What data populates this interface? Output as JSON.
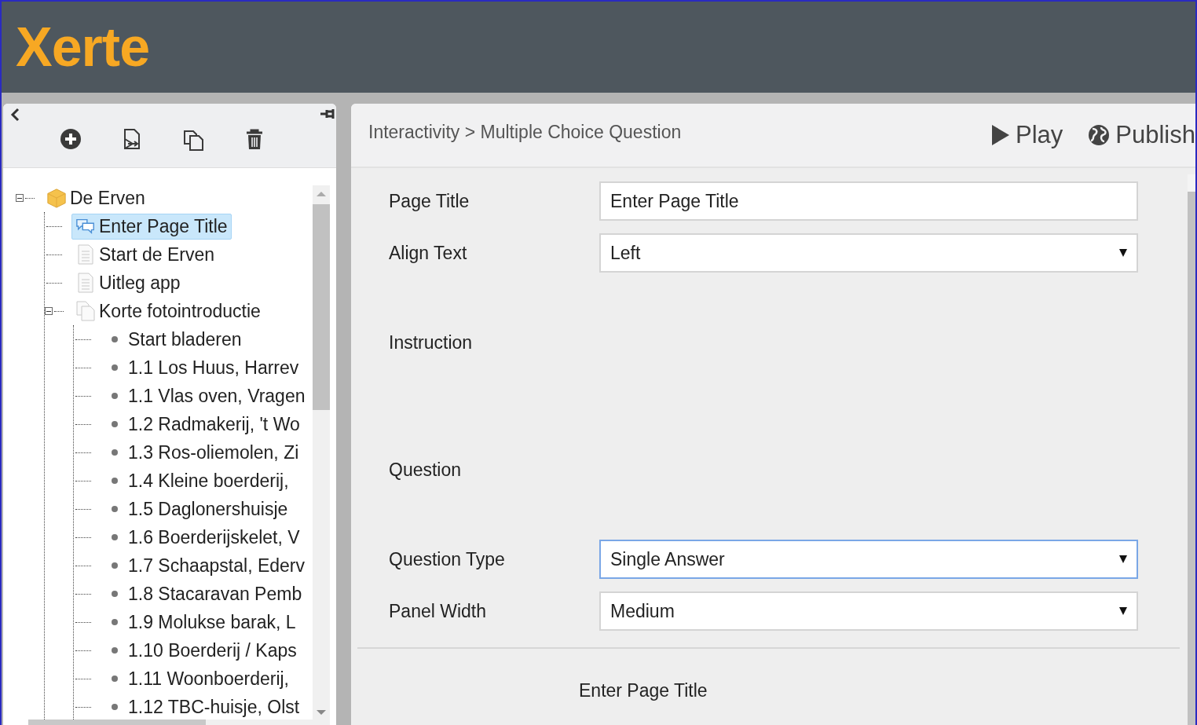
{
  "logo": {
    "text": "Xerte"
  },
  "tree": {
    "items": [
      {
        "label": "De Erven",
        "kind": "project",
        "expanded": true,
        "selected": false,
        "children": [
          {
            "label": "Enter Page Title",
            "kind": "question",
            "selected": true
          },
          {
            "label": "Start de Erven",
            "kind": "page",
            "selected": false
          },
          {
            "label": "Uitleg app",
            "kind": "page",
            "selected": false
          },
          {
            "label": "Korte fotointroductie",
            "kind": "group",
            "expanded": true,
            "selected": false,
            "children": [
              {
                "label": "Start bladeren",
                "kind": "item",
                "selected": false
              },
              {
                "label": "1.1 Los Huus, Harrev",
                "kind": "item",
                "selected": false
              },
              {
                "label": "1.1 Vlas oven, Vragen",
                "kind": "item",
                "selected": false
              },
              {
                "label": "1.2 Radmakerij, 't Wo",
                "kind": "item",
                "selected": false
              },
              {
                "label": "1.3 Ros-oliemolen, Zi",
                "kind": "item",
                "selected": false
              },
              {
                "label": "1.4 Kleine boerderij,",
                "kind": "item",
                "selected": false
              },
              {
                "label": "1.5 Daglonershuisje",
                "kind": "item",
                "selected": false
              },
              {
                "label": "1.6 Boerderijskelet, V",
                "kind": "item",
                "selected": false
              },
              {
                "label": "1.7 Schaapstal, Ederv",
                "kind": "item",
                "selected": false
              },
              {
                "label": "1.8 Stacaravan Pemb",
                "kind": "item",
                "selected": false
              },
              {
                "label": "1.9 Molukse barak, L",
                "kind": "item",
                "selected": false
              },
              {
                "label": "1.10 Boerderij / Kaps",
                "kind": "item",
                "selected": false
              },
              {
                "label": "1.11 Woonboerderij,",
                "kind": "item",
                "selected": false
              },
              {
                "label": "1.12 TBC-huisje, Olst",
                "kind": "item",
                "selected": false
              }
            ]
          }
        ]
      }
    ]
  },
  "editor": {
    "breadcrumb": "Interactivity > Multiple Choice Question",
    "actions": [
      {
        "label": "Play",
        "kind": "play"
      },
      {
        "label": "Publish",
        "kind": "publish"
      }
    ],
    "fields": [
      {
        "label": "Page Title",
        "kind": "text",
        "value": "Enter Page Title",
        "focused": false
      },
      {
        "label": "Align Text",
        "kind": "select",
        "value": "Left",
        "focused": false
      },
      {
        "label": "Instruction",
        "kind": "area"
      },
      {
        "label": "Question",
        "kind": "area"
      },
      {
        "label": "Question Type",
        "kind": "select",
        "value": "Single Answer",
        "focused": true
      },
      {
        "label": "Panel Width",
        "kind": "select",
        "value": "Medium",
        "focused": false
      }
    ],
    "preview_title": "Enter Page Title"
  }
}
